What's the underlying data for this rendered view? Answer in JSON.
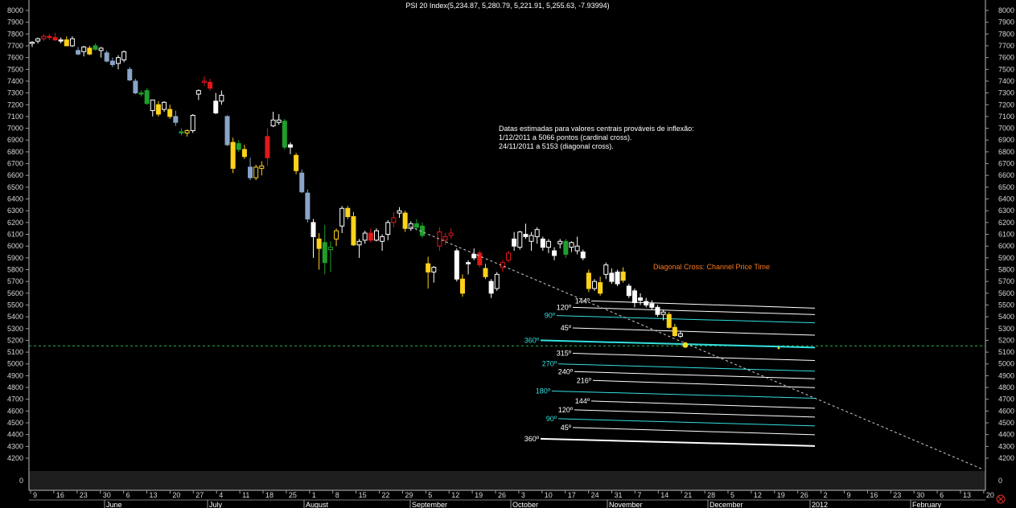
{
  "chart_data": {
    "type": "candlestick",
    "title": "PSI 20 Index(5,234.87, 5,280.79, 5,221.91, 5,255.63, -7.93994)",
    "ylim": [
      4150,
      8050
    ],
    "y_ticks": [
      8000,
      7900,
      7800,
      7700,
      7600,
      7500,
      7400,
      7300,
      7200,
      7100,
      7000,
      6900,
      6800,
      6700,
      6600,
      6500,
      6400,
      6300,
      6200,
      6100,
      6000,
      5900,
      5800,
      5700,
      5600,
      5500,
      5400,
      5300,
      5200,
      5100,
      5000,
      4900,
      4800,
      4700,
      4600,
      4500,
      4400,
      4300,
      4200
    ],
    "volume_tick": "0",
    "day_ticks": [
      "9",
      "16",
      "23",
      "30",
      "6",
      "13",
      "20",
      "27",
      "4",
      "11",
      "18",
      "25",
      "1",
      "8",
      "15",
      "22",
      "29",
      "5",
      "12",
      "19",
      "26",
      "3",
      "10",
      "17",
      "24",
      "31",
      "7",
      "14",
      "21",
      "28",
      "5",
      "12",
      "19",
      "26",
      "2",
      "9",
      "16",
      "23",
      "30",
      "6",
      "13",
      "20"
    ],
    "months": [
      "June",
      "July",
      "August",
      "September",
      "October",
      "November",
      "December",
      "2012",
      "February"
    ],
    "annotation_lines": [
      "Datas estimadas para valores centrais prováveis de inflexão:",
      "1/12/2011 a 5066 pontos (cardinal cross).",
      "24/11/2011 a 5153 (diagonal cross)."
    ],
    "diagonal_cross_label": "Diagonal Cross: Channel Price Time",
    "reference_level": 5153,
    "fan_upper": [
      {
        "label": "144º",
        "value": 5535,
        "color": "#ffffff"
      },
      {
        "label": "120º",
        "value": 5480,
        "color": "#ffffff"
      },
      {
        "label": "90º",
        "value": 5410,
        "color": "#33e0e0"
      },
      {
        "label": "45º",
        "value": 5305,
        "color": "#ffffff"
      },
      {
        "label": "360º",
        "value": 5200,
        "color": "#33e0e0"
      }
    ],
    "fan_lower": [
      {
        "label": "315º",
        "value": 5090,
        "color": "#ffffff"
      },
      {
        "label": "270º",
        "value": 5000,
        "color": "#33e0e0"
      },
      {
        "label": "240º",
        "value": 4935,
        "color": "#ffffff"
      },
      {
        "label": "216º",
        "value": 4860,
        "color": "#ffffff"
      },
      {
        "label": "180º",
        "value": 4770,
        "color": "#33e0e0"
      },
      {
        "label": "144º",
        "value": 4685,
        "color": "#ffffff"
      },
      {
        "label": "120º",
        "value": 4610,
        "color": "#ffffff"
      },
      {
        "label": "90º",
        "value": 4535,
        "color": "#33e0e0"
      },
      {
        "label": "45º",
        "value": 4460,
        "color": "#ffffff"
      },
      {
        "label": "360º",
        "value": 4365,
        "color": "#ffffff"
      }
    ],
    "candles": [
      {
        "o": 7720,
        "h": 7740,
        "l": 7690,
        "c": 7730,
        "col": "white"
      },
      {
        "o": 7740,
        "h": 7770,
        "l": 7720,
        "c": 7760,
        "col": "white"
      },
      {
        "o": 7760,
        "h": 7800,
        "l": 7740,
        "c": 7780,
        "col": "red"
      },
      {
        "o": 7780,
        "h": 7800,
        "l": 7750,
        "c": 7770,
        "col": "red"
      },
      {
        "o": 7770,
        "h": 7810,
        "l": 7740,
        "c": 7750,
        "col": "red"
      },
      {
        "o": 7750,
        "h": 7770,
        "l": 7720,
        "c": 7740,
        "col": "white"
      },
      {
        "o": 7750,
        "h": 7780,
        "l": 7700,
        "c": 7700,
        "col": "yellow"
      },
      {
        "o": 7700,
        "h": 7780,
        "l": 7690,
        "c": 7760,
        "col": "white"
      },
      {
        "o": 7660,
        "h": 7690,
        "l": 7620,
        "c": 7630,
        "col": "blue"
      },
      {
        "o": 7650,
        "h": 7700,
        "l": 7610,
        "c": 7690,
        "col": "white"
      },
      {
        "o": 7680,
        "h": 7700,
        "l": 7620,
        "c": 7630,
        "col": "yellow"
      },
      {
        "o": 7700,
        "h": 7720,
        "l": 7660,
        "c": 7670,
        "col": "green"
      },
      {
        "o": 7660,
        "h": 7690,
        "l": 7600,
        "c": 7680,
        "col": "white"
      },
      {
        "o": 7640,
        "h": 7660,
        "l": 7560,
        "c": 7570,
        "col": "blue"
      },
      {
        "o": 7570,
        "h": 7600,
        "l": 7520,
        "c": 7540,
        "col": "blue"
      },
      {
        "o": 7550,
        "h": 7620,
        "l": 7500,
        "c": 7600,
        "col": "white"
      },
      {
        "o": 7580,
        "h": 7660,
        "l": 7560,
        "c": 7650,
        "col": "white"
      },
      {
        "o": 7500,
        "h": 7520,
        "l": 7400,
        "c": 7410,
        "col": "blue"
      },
      {
        "o": 7400,
        "h": 7420,
        "l": 7290,
        "c": 7300,
        "col": "blue"
      },
      {
        "o": 7300,
        "h": 7320,
        "l": 7270,
        "c": 7290,
        "col": "green"
      },
      {
        "o": 7320,
        "h": 7340,
        "l": 7200,
        "c": 7210,
        "col": "green"
      },
      {
        "o": 7150,
        "h": 7240,
        "l": 7100,
        "c": 7240,
        "col": "white"
      },
      {
        "o": 7200,
        "h": 7230,
        "l": 7100,
        "c": 7120,
        "col": "yellow"
      },
      {
        "o": 7160,
        "h": 7230,
        "l": 7140,
        "c": 7220,
        "col": "white"
      },
      {
        "o": 7160,
        "h": 7200,
        "l": 7080,
        "c": 7100,
        "col": "yellow"
      },
      {
        "o": 7100,
        "h": 7150,
        "l": 7020,
        "c": 7050,
        "col": "blue"
      },
      {
        "o": 6970,
        "h": 7000,
        "l": 6940,
        "c": 6960,
        "col": "green"
      },
      {
        "o": 6960,
        "h": 6990,
        "l": 6930,
        "c": 6980,
        "col": "yellow"
      },
      {
        "o": 6980,
        "h": 7120,
        "l": 6960,
        "c": 7110,
        "col": "white"
      },
      {
        "o": 7290,
        "h": 7330,
        "l": 7240,
        "c": 7320,
        "col": "white"
      },
      {
        "o": 7390,
        "h": 7440,
        "l": 7360,
        "c": 7400,
        "col": "red"
      },
      {
        "o": 7390,
        "h": 7420,
        "l": 7320,
        "c": 7340,
        "col": "red"
      },
      {
        "o": 7230,
        "h": 7300,
        "l": 7120,
        "c": 7130,
        "col": "white"
      },
      {
        "o": 7230,
        "h": 7320,
        "l": 7200,
        "c": 7280,
        "col": "white"
      },
      {
        "o": 7100,
        "h": 7110,
        "l": 6850,
        "c": 6860,
        "col": "blue"
      },
      {
        "o": 6880,
        "h": 6920,
        "l": 6620,
        "c": 6660,
        "col": "yellow"
      },
      {
        "o": 6870,
        "h": 6900,
        "l": 6800,
        "c": 6820,
        "col": "green"
      },
      {
        "o": 6820,
        "h": 6860,
        "l": 6740,
        "c": 6760,
        "col": "yellow"
      },
      {
        "o": 6670,
        "h": 6750,
        "l": 6560,
        "c": 6580,
        "col": "blue"
      },
      {
        "o": 6580,
        "h": 6690,
        "l": 6560,
        "c": 6670,
        "col": "yellow"
      },
      {
        "o": 6660,
        "h": 6720,
        "l": 6600,
        "c": 6680,
        "col": "yellow"
      },
      {
        "o": 6930,
        "h": 7000,
        "l": 6680,
        "c": 6750,
        "col": "red"
      },
      {
        "o": 7020,
        "h": 7140,
        "l": 7010,
        "c": 7070,
        "col": "white"
      },
      {
        "o": 7050,
        "h": 7120,
        "l": 7030,
        "c": 7070,
        "col": "white"
      },
      {
        "o": 7060,
        "h": 7080,
        "l": 6820,
        "c": 6840,
        "col": "green"
      },
      {
        "o": 6860,
        "h": 6880,
        "l": 6780,
        "c": 6840,
        "col": "white"
      },
      {
        "o": 6770,
        "h": 6790,
        "l": 6610,
        "c": 6640,
        "col": "yellow"
      },
      {
        "o": 6620,
        "h": 6650,
        "l": 6450,
        "c": 6460,
        "col": "blue"
      },
      {
        "o": 6450,
        "h": 6480,
        "l": 6200,
        "c": 6230,
        "col": "blue"
      },
      {
        "o": 6200,
        "h": 6230,
        "l": 5900,
        "c": 6080,
        "col": "white"
      },
      {
        "o": 6060,
        "h": 6110,
        "l": 5800,
        "c": 5980,
        "col": "yellow"
      },
      {
        "o": 6030,
        "h": 6180,
        "l": 5760,
        "c": 5860,
        "col": "green"
      },
      {
        "o": 5970,
        "h": 6040,
        "l": 5780,
        "c": 5990,
        "col": "green"
      },
      {
        "o": 6060,
        "h": 6150,
        "l": 6000,
        "c": 6130,
        "col": "yellow"
      },
      {
        "o": 6170,
        "h": 6340,
        "l": 6110,
        "c": 6320,
        "col": "white"
      },
      {
        "o": 6320,
        "h": 6340,
        "l": 6230,
        "c": 6250,
        "col": "yellow"
      },
      {
        "o": 6250,
        "h": 6290,
        "l": 6000,
        "c": 6010,
        "col": "yellow"
      },
      {
        "o": 6010,
        "h": 6060,
        "l": 5900,
        "c": 6040,
        "col": "white"
      },
      {
        "o": 6050,
        "h": 6130,
        "l": 6020,
        "c": 6110,
        "col": "white"
      },
      {
        "o": 6110,
        "h": 6150,
        "l": 6030,
        "c": 6050,
        "col": "red"
      },
      {
        "o": 6050,
        "h": 6150,
        "l": 6040,
        "c": 6130,
        "col": "white"
      },
      {
        "o": 6040,
        "h": 6100,
        "l": 5960,
        "c": 6080,
        "col": "white"
      },
      {
        "o": 6100,
        "h": 6220,
        "l": 6050,
        "c": 6200,
        "col": "white"
      },
      {
        "o": 6200,
        "h": 6290,
        "l": 6160,
        "c": 6240,
        "col": "red"
      },
      {
        "o": 6280,
        "h": 6330,
        "l": 6240,
        "c": 6300,
        "col": "white"
      },
      {
        "o": 6280,
        "h": 6300,
        "l": 6120,
        "c": 6150,
        "col": "yellow"
      },
      {
        "o": 6150,
        "h": 6210,
        "l": 6130,
        "c": 6190,
        "col": "white"
      },
      {
        "o": 6190,
        "h": 6230,
        "l": 6130,
        "c": 6160,
        "col": "green"
      },
      {
        "o": 6170,
        "h": 6200,
        "l": 6070,
        "c": 6090,
        "col": "green"
      },
      {
        "o": 5850,
        "h": 5910,
        "l": 5640,
        "c": 5780,
        "col": "yellow"
      },
      {
        "o": 5780,
        "h": 5830,
        "l": 5690,
        "c": 5820,
        "col": "white"
      },
      {
        "o": 6000,
        "h": 6160,
        "l": 5960,
        "c": 6120,
        "col": "red"
      },
      {
        "o": 6050,
        "h": 6110,
        "l": 6010,
        "c": 6080,
        "col": "red"
      },
      {
        "o": 6090,
        "h": 6150,
        "l": 6060,
        "c": 6110,
        "col": "red"
      },
      {
        "o": 5960,
        "h": 5980,
        "l": 5700,
        "c": 5720,
        "col": "white"
      },
      {
        "o": 5720,
        "h": 5760,
        "l": 5570,
        "c": 5600,
        "col": "yellow"
      },
      {
        "o": 5860,
        "h": 5880,
        "l": 5760,
        "c": 5850,
        "col": "white"
      },
      {
        "o": 5930,
        "h": 5980,
        "l": 5880,
        "c": 5900,
        "col": "white"
      },
      {
        "o": 5940,
        "h": 5960,
        "l": 5820,
        "c": 5840,
        "col": "red"
      },
      {
        "o": 5810,
        "h": 5850,
        "l": 5720,
        "c": 5740,
        "col": "yellow"
      },
      {
        "o": 5700,
        "h": 5720,
        "l": 5560,
        "c": 5600,
        "col": "white"
      },
      {
        "o": 5640,
        "h": 5780,
        "l": 5620,
        "c": 5760,
        "col": "white"
      },
      {
        "o": 5820,
        "h": 5880,
        "l": 5780,
        "c": 5860,
        "col": "red"
      },
      {
        "o": 5880,
        "h": 5960,
        "l": 5860,
        "c": 5940,
        "col": "red"
      },
      {
        "o": 6060,
        "h": 6120,
        "l": 5960,
        "c": 6000,
        "col": "white"
      },
      {
        "o": 5990,
        "h": 6130,
        "l": 5970,
        "c": 6120,
        "col": "white"
      },
      {
        "o": 6100,
        "h": 6190,
        "l": 6060,
        "c": 6080,
        "col": "white"
      },
      {
        "o": 6040,
        "h": 6120,
        "l": 5960,
        "c": 6090,
        "col": "white"
      },
      {
        "o": 6080,
        "h": 6160,
        "l": 6020,
        "c": 6140,
        "col": "white"
      },
      {
        "o": 6060,
        "h": 6080,
        "l": 5960,
        "c": 5990,
        "col": "white"
      },
      {
        "o": 5990,
        "h": 6060,
        "l": 5940,
        "c": 6040,
        "col": "white"
      },
      {
        "o": 5960,
        "h": 5990,
        "l": 5880,
        "c": 5920,
        "col": "white"
      },
      {
        "o": 6020,
        "h": 6060,
        "l": 5980,
        "c": 6040,
        "col": "white"
      },
      {
        "o": 6040,
        "h": 6060,
        "l": 5900,
        "c": 5930,
        "col": "green"
      },
      {
        "o": 5990,
        "h": 6040,
        "l": 5950,
        "c": 6030,
        "col": "white"
      },
      {
        "o": 5960,
        "h": 6080,
        "l": 5930,
        "c": 6000,
        "col": "white"
      },
      {
        "o": 5950,
        "h": 5970,
        "l": 5880,
        "c": 5900,
        "col": "white"
      },
      {
        "o": 5770,
        "h": 5800,
        "l": 5610,
        "c": 5640,
        "col": "yellow"
      },
      {
        "o": 5640,
        "h": 5720,
        "l": 5620,
        "c": 5700,
        "col": "white"
      },
      {
        "o": 5690,
        "h": 5740,
        "l": 5580,
        "c": 5600,
        "col": "yellow"
      },
      {
        "o": 5760,
        "h": 5860,
        "l": 5720,
        "c": 5840,
        "col": "white"
      },
      {
        "o": 5770,
        "h": 5810,
        "l": 5680,
        "c": 5700,
        "col": "white"
      },
      {
        "o": 5780,
        "h": 5800,
        "l": 5660,
        "c": 5680,
        "col": "white"
      },
      {
        "o": 5780,
        "h": 5820,
        "l": 5690,
        "c": 5710,
        "col": "yellow"
      },
      {
        "o": 5660,
        "h": 5680,
        "l": 5560,
        "c": 5580,
        "col": "white"
      },
      {
        "o": 5620,
        "h": 5640,
        "l": 5480,
        "c": 5520,
        "col": "white"
      },
      {
        "o": 5560,
        "h": 5600,
        "l": 5500,
        "c": 5540,
        "col": "white"
      },
      {
        "o": 5530,
        "h": 5560,
        "l": 5480,
        "c": 5500,
        "col": "white"
      },
      {
        "o": 5510,
        "h": 5540,
        "l": 5460,
        "c": 5480,
        "col": "white"
      },
      {
        "o": 5480,
        "h": 5500,
        "l": 5400,
        "c": 5420,
        "col": "white"
      },
      {
        "o": 5420,
        "h": 5460,
        "l": 5370,
        "c": 5440,
        "col": "white"
      },
      {
        "o": 5420,
        "h": 5440,
        "l": 5300,
        "c": 5310,
        "col": "yellow"
      },
      {
        "o": 5310,
        "h": 5340,
        "l": 5230,
        "c": 5240,
        "col": "yellow"
      },
      {
        "o": 5235,
        "h": 5281,
        "l": 5222,
        "c": 5256,
        "col": "white"
      }
    ]
  },
  "colors": {
    "white": "#ffffff",
    "yellow": "#ffd21a",
    "red": "#e01818",
    "green": "#1f9e2c",
    "blue": "#8aa4c8",
    "cyan": "#33e0e0",
    "orange": "#ff7a1a"
  },
  "status_icon": "close-circle-icon"
}
